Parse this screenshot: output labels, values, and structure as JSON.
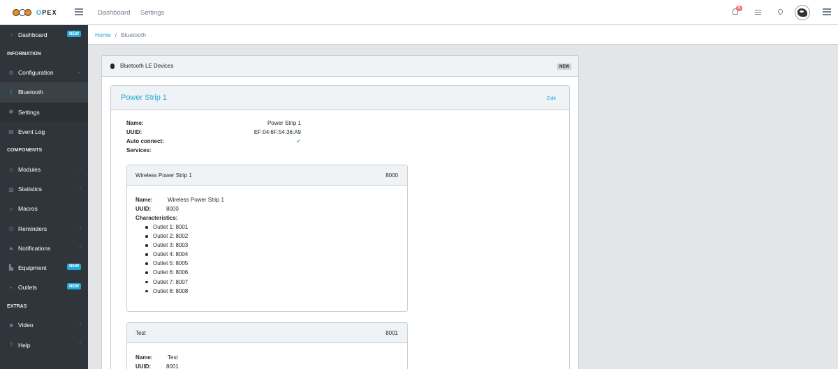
{
  "brand": {
    "name_prefix": "O",
    "name_suffix": "PEX"
  },
  "header": {
    "nav": [
      "Dashboard",
      "Settings"
    ],
    "notification_count": "5"
  },
  "breadcrumb": {
    "home": "Home",
    "current": "Bluetooth"
  },
  "sidebar": {
    "items": [
      {
        "type": "item",
        "label": "Dashboard",
        "icon": "speedometer-icon",
        "badge": "NEW"
      },
      {
        "type": "title",
        "label": "INFORMATION"
      },
      {
        "type": "item",
        "label": "Configuration",
        "icon": "cogs-icon",
        "chevron": true
      },
      {
        "type": "item",
        "label": "Bluetooth",
        "icon": "bluetooth-icon",
        "active": true
      },
      {
        "type": "item",
        "label": "Settings",
        "icon": "gear-icon"
      },
      {
        "type": "item",
        "label": "Event Log",
        "icon": "clipboard-icon"
      },
      {
        "type": "title",
        "label": "COMPONENTS"
      },
      {
        "type": "item",
        "label": "Modules",
        "icon": "puzzle-icon",
        "chevron": true
      },
      {
        "type": "item",
        "label": "Statistics",
        "icon": "bar-chart-icon",
        "chevron": true
      },
      {
        "type": "item",
        "label": "Macros",
        "icon": "code-icon"
      },
      {
        "type": "item",
        "label": "Reminders",
        "icon": "clock-icon",
        "chevron": true
      },
      {
        "type": "item",
        "label": "Notifications",
        "icon": "warning-icon",
        "chevron": true
      },
      {
        "type": "item",
        "label": "Equipment",
        "icon": "chart-icon",
        "badge": "NEW"
      },
      {
        "type": "item",
        "label": "Outlets",
        "icon": "plug-icon",
        "badge": "NEW"
      },
      {
        "type": "title",
        "label": "EXTRAS"
      },
      {
        "type": "item",
        "label": "Video",
        "icon": "video-icon",
        "chevron": true
      },
      {
        "type": "item",
        "label": "Help",
        "icon": "question-icon",
        "chevron": true
      }
    ]
  },
  "main_card": {
    "title": "Bluetooth LE Devices",
    "badge": "NEW",
    "device": {
      "title": "Power Strip 1",
      "edit_label": "Edit",
      "labels": {
        "name": "Name:",
        "uuid": "UUID:",
        "auto_connect": "Auto connect:",
        "services": "Services:"
      },
      "name": "Power Strip 1",
      "uuid": "EF:04:6F:54:36:A9",
      "auto_connect_mark": "✔",
      "services": [
        {
          "title": "Wireless Power Strip 1",
          "uuid": "8000",
          "name_label": "Name:",
          "name": "Wireless Power Strip 1",
          "uuid_label": "UUID:",
          "characteristics_label": "Characteristics:",
          "characteristics": [
            "Outlet 1: 8001",
            "Outlet 2: 8002",
            "Outlet 3: 8003",
            "Outlet 4: 8004",
            "Outlet 5: 8005",
            "Outlet 6: 8006",
            "Outlet 7: 8007",
            "Outlet 8: 8008"
          ]
        },
        {
          "title": "Test",
          "uuid": "8001",
          "name_label": "Name:",
          "name": "Test",
          "uuid_label": "UUID:"
        }
      ]
    }
  },
  "colors": {
    "primary": "#20a8d8",
    "sidebar": "#2f353a",
    "success": "#4dbd74",
    "danger": "#f86c6b"
  }
}
